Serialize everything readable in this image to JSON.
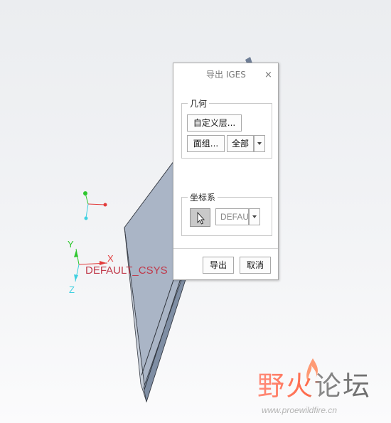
{
  "dialog": {
    "title": "导出 IGES",
    "close_glyph": "×",
    "geometry_group": {
      "legend": "几何",
      "custom_layers_label": "自定义层...",
      "quilts_label": "面组...",
      "all_selected": "全部"
    },
    "csys_group": {
      "legend": "坐标系",
      "selector_icon": "cursor-arrow-icon",
      "csys_value": "DEFAUL"
    },
    "export_label": "导出",
    "cancel_label": "取消"
  },
  "viewport": {
    "csys_name": "DEFAULT_CSYS",
    "axes": {
      "x": "X",
      "y": "Y",
      "z": "Z"
    },
    "colors": {
      "part_face": "#a9b4c4",
      "axis_red": "#e23b3b",
      "axis_green": "#2ec72e",
      "axis_cyan": "#3fd0e0",
      "annotation": "#e8231c"
    }
  },
  "watermark": {
    "brand_cn": "野火论坛",
    "url": "www.proewildfire.cn"
  }
}
